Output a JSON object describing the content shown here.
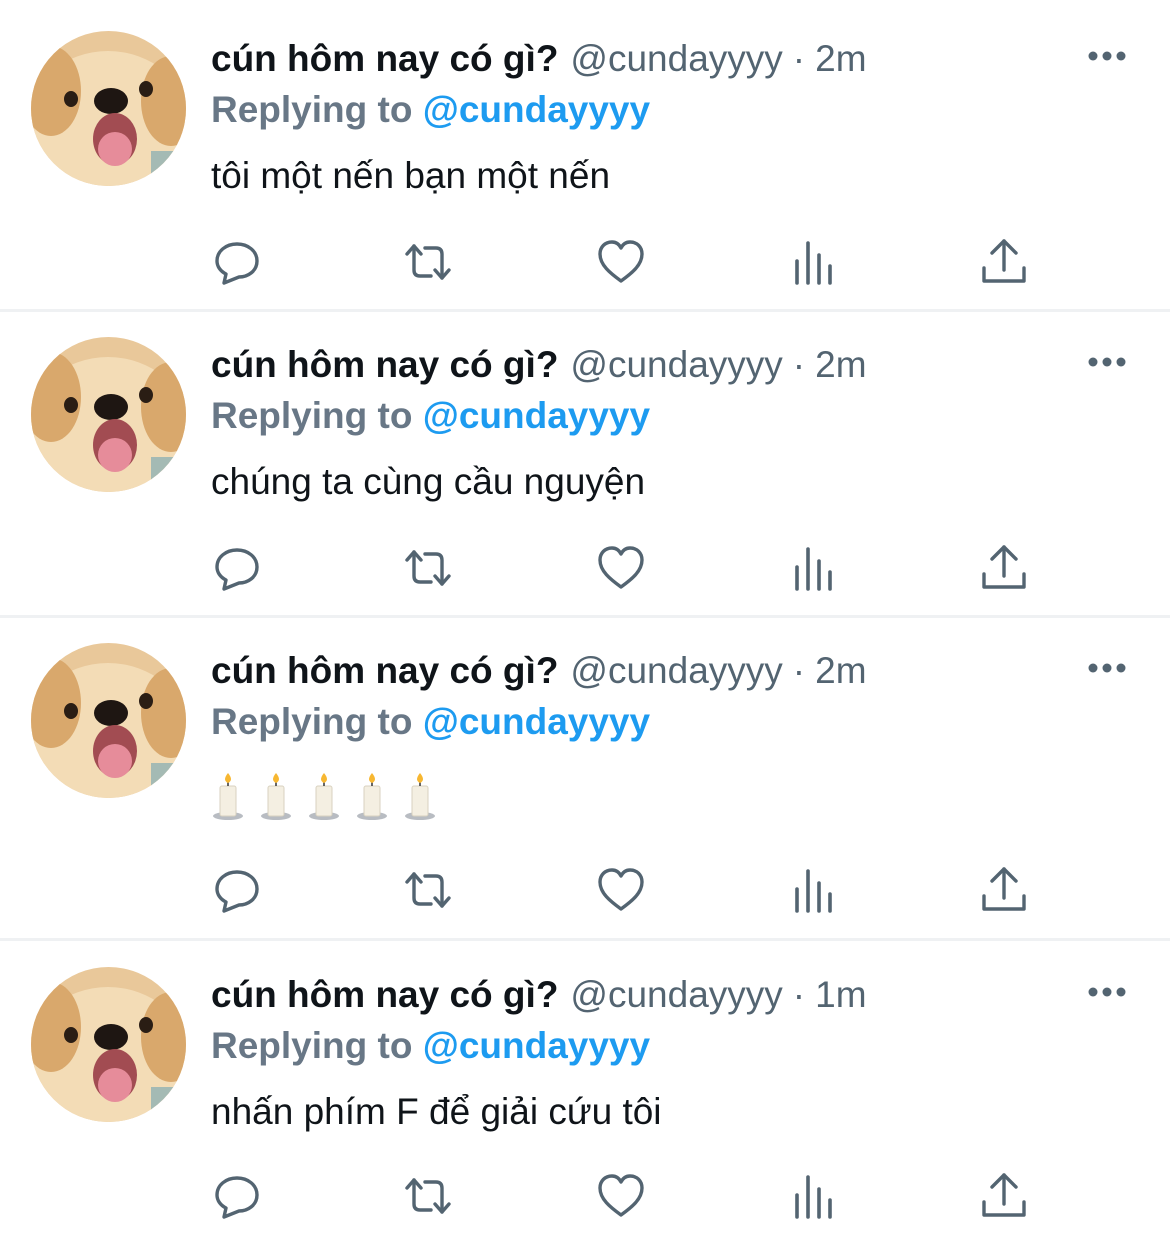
{
  "tweets": [
    {
      "display_name": "cún hôm nay có gì?",
      "handle": "@cundayyyy",
      "separator": "·",
      "time": "2m",
      "replying_label": "Replying to",
      "replying_handle": "@cundayyyy",
      "text": "tôi một nến bạn một nến"
    },
    {
      "display_name": "cún hôm nay có gì?",
      "handle": "@cundayyyy",
      "separator": "·",
      "time": "2m",
      "replying_label": "Replying to",
      "replying_handle": "@cundayyyy",
      "text": "chúng ta cùng cầu nguyện"
    },
    {
      "display_name": "cún hôm nay có gì?",
      "handle": "@cundayyyy",
      "separator": "·",
      "time": "2m",
      "replying_label": "Replying to",
      "replying_handle": "@cundayyyy",
      "text": "🕯🕯🕯🕯🕯",
      "candle_count": 5
    },
    {
      "display_name": "cún hôm nay có gì?",
      "handle": "@cundayyyy",
      "separator": "·",
      "time": "1m",
      "replying_label": "Replying to",
      "replying_handle": "@cundayyyy",
      "text": "nhấn phím F để giải cứu tôi"
    }
  ],
  "action_icons": [
    "reply-icon",
    "retweet-icon",
    "like-icon",
    "analytics-icon",
    "share-icon"
  ],
  "colors": {
    "name": "#0f1419",
    "secondary": "#536471",
    "mention": "#1d9bf0",
    "icon": "#536471",
    "divider": "#eff1f3"
  }
}
